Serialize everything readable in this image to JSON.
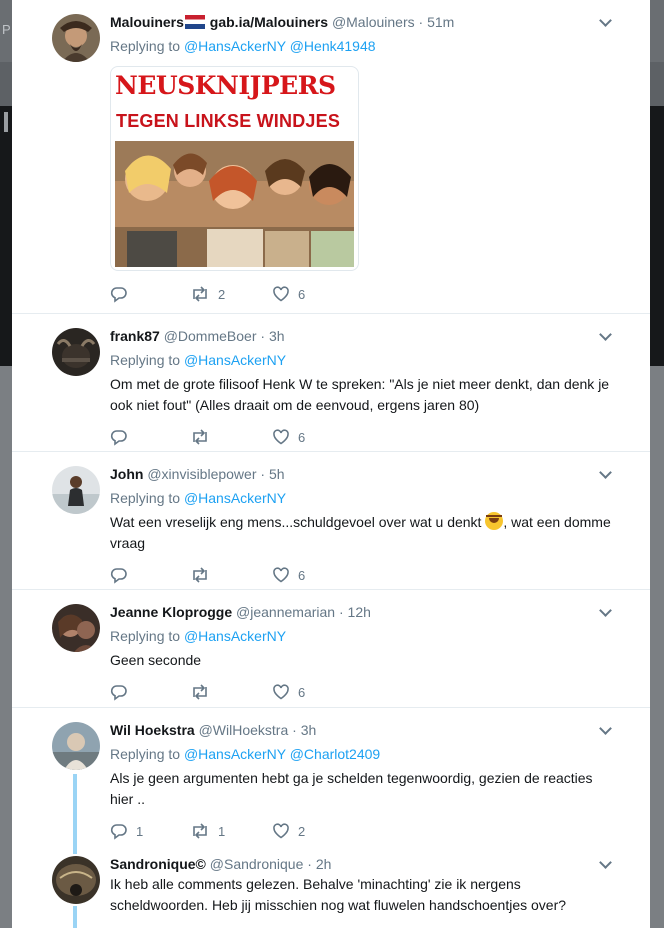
{
  "background": {
    "letter": "P"
  },
  "tweets": [
    {
      "name": "Malouiners",
      "name_suffix": "gab.ia/Malouiners",
      "handle": "@Malouiners",
      "time": "51m",
      "replying_label": "Replying to",
      "mentions": [
        "@HansAckerNY",
        "@Henk41948"
      ],
      "media": {
        "line1": "NEUSKNIJPERS",
        "line2": "TEGEN LINKSE WINDJES"
      },
      "replies": "",
      "retweets": "2",
      "likes": "6"
    },
    {
      "name": "frank87",
      "handle": "@DommeBoer",
      "time": "3h",
      "replying_label": "Replying to",
      "mentions": [
        "@HansAckerNY"
      ],
      "text": "Om met de grote filisoof Henk W te spreken: \"Als je niet meer denkt, dan denk je ook niet fout\" (Alles draait om de eenvoud, ergens jaren 80)",
      "replies": "",
      "retweets": "",
      "likes": "6"
    },
    {
      "name": "John",
      "handle": "@xinvisiblepower",
      "time": "5h",
      "replying_label": "Replying to",
      "mentions": [
        "@HansAckerNY"
      ],
      "text_before": "Wat een vreselijk eng mens...schuldgevoel over wat u denkt ",
      "text_after": ", wat een domme vraag",
      "replies": "",
      "retweets": "",
      "likes": "6"
    },
    {
      "name": "Jeanne Kloprogge",
      "handle": "@jeannemarian",
      "time": "12h",
      "replying_label": "Replying to",
      "mentions": [
        "@HansAckerNY"
      ],
      "text": "Geen seconde",
      "replies": "",
      "retweets": "",
      "likes": "6"
    },
    {
      "name": "Wil Hoekstra",
      "handle": "@WilHoekstra",
      "time": "3h",
      "replying_label": "Replying to",
      "mentions": [
        "@HansAckerNY",
        "@Charlot2409"
      ],
      "text": "Als je geen argumenten hebt ga je schelden tegenwoordig, gezien de reacties hier ..",
      "replies": "1",
      "retweets": "1",
      "likes": "2"
    },
    {
      "name": "Sandronique©",
      "handle": "@Sandronique",
      "time": "2h",
      "text": "Ik heb alle comments gelezen. Behalve 'minachting' zie ik nergens scheldwoorden. Heb jij misschien nog wat fluwelen handschoentjes over?"
    }
  ],
  "colors": {
    "link": "#1da1f2",
    "text": "#14171a",
    "muted": "#657786",
    "thread_line": "#9ad4f5"
  }
}
